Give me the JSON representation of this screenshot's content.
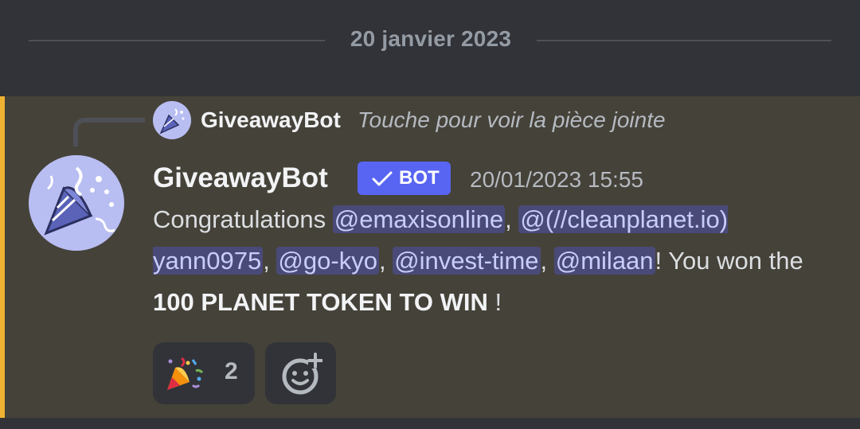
{
  "date_divider": "20 janvier 2023",
  "reply": {
    "author": "GiveawayBot",
    "content": "Touche pour voir la pièce jointe"
  },
  "message": {
    "author": "GiveawayBot",
    "tag": "BOT",
    "timestamp": "20/01/2023 15:55",
    "text_before": "Congratulations ",
    "mentions": [
      "@emaxisonline",
      "@(//cleanplanet.io) yann0975",
      "@go-kyo",
      "@invest-time",
      "@milaan"
    ],
    "separator": ", ",
    "text_after": "! You won the ",
    "bold": "100 PLANET TOKEN TO WIN",
    "text_end": " !"
  },
  "reactions": [
    {
      "emoji": "party-popper-icon",
      "count": "2"
    }
  ],
  "colors": {
    "accent": "#f0b232",
    "bot_tag": "#5865f2",
    "mention_bg": "#4a4a78",
    "message_highlight": "#454239"
  }
}
